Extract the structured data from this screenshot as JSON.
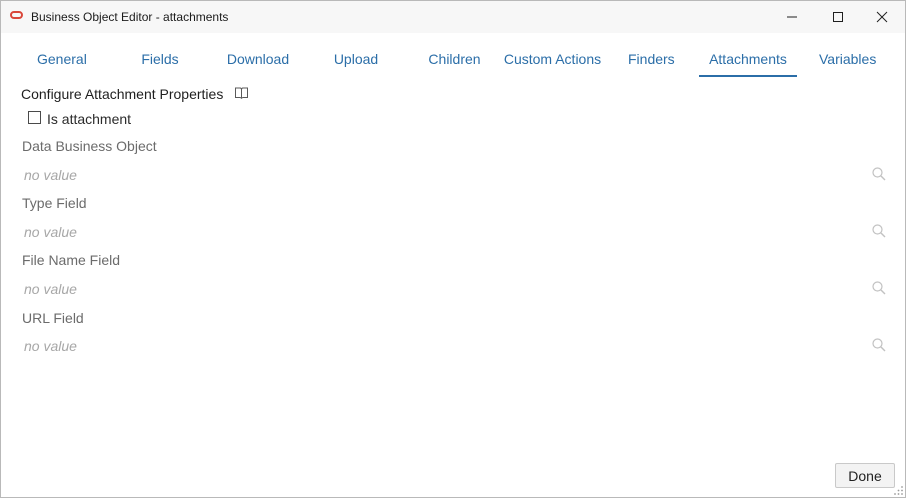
{
  "window": {
    "title": "Business Object Editor - attachments",
    "controls": [
      "minimize-icon",
      "maximize-icon",
      "close-icon"
    ]
  },
  "tabs": [
    {
      "label": "General"
    },
    {
      "label": "Fields"
    },
    {
      "label": "Download"
    },
    {
      "label": "Upload"
    },
    {
      "label": "Children"
    },
    {
      "label": "Custom Actions"
    },
    {
      "label": "Finders"
    },
    {
      "label": "Attachments",
      "active": true
    },
    {
      "label": "Variables"
    }
  ],
  "section": {
    "title": "Configure Attachment Properties",
    "icon": "book-icon"
  },
  "is_attachment": {
    "label": "Is attachment",
    "checked": false
  },
  "fields": [
    {
      "label": "Data Business Object",
      "value": "no value",
      "icon": "search-icon"
    },
    {
      "label": "Type Field",
      "value": "no value",
      "icon": "search-icon"
    },
    {
      "label": "File Name Field",
      "value": "no value",
      "icon": "search-icon"
    },
    {
      "label": "URL Field",
      "value": "no value",
      "icon": "search-icon"
    }
  ],
  "footer": {
    "done_label": "Done"
  },
  "colors": {
    "accent": "#2b6ea8",
    "brand_icon": "#d9463a",
    "placeholder": "#a7a7a7"
  }
}
